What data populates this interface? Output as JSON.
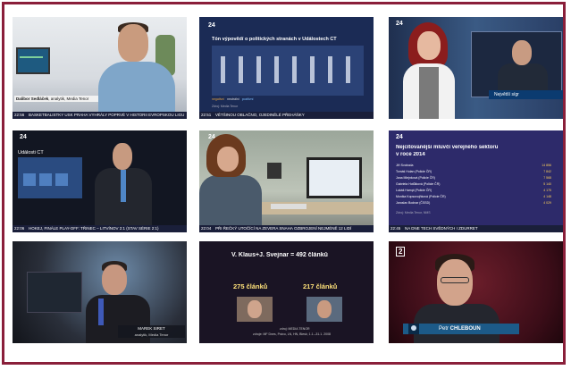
{
  "tiles": {
    "t1": {
      "name_bold": "Dalibor Sedláček",
      "name_rest": ", analytik, Media Tenor",
      "time": "22:56",
      "ticker": "BASKETBALISTKY USK PRAHA VYHRÁLY POPRVÉ V HISTORII EVROPSKOU LIGU"
    },
    "t2": {
      "title": "Tón výpovědí o politických stranách v Událostech ČT",
      "source": "Zdroj: Media Tenor",
      "legend": [
        "negativní",
        "neutrální",
        "pozitivní"
      ],
      "time": "22:51",
      "ticker": "VĚTŠINOU OBLAČNO, OJEDINĚLÉ PŘEHÁŇKY"
    },
    "t3": {
      "caption": "Největší sígr"
    },
    "t4": {
      "panel_title": "Události ČT",
      "time": "22:06",
      "ticker": "HOKEJ, FINÁLE PLAY-OFF: TŘINEC – LITVÍNOV 2:1 (STAV SÉRIE 2:1)"
    },
    "t5": {
      "time": "22:04",
      "ticker": "PŘI ŘEČKÝ UTOČÍCÍ NA ZEVERA SNAHA OZBROJENÍ NEJMÉNĚ 12 LIDÍ"
    },
    "t6": {
      "title_line1": "Nejcitovanější mluvčí veřejného sektoru",
      "title_line2": "v roce 2014",
      "rows": [
        {
          "name": "Jiří Svoboda",
          "value": "14 856"
        },
        {
          "name": "Tomáš Hulan (Policie ČR)",
          "value": "7 842"
        },
        {
          "name": "Jana Mlejnková (Policie ČR)",
          "value": "7 568"
        },
        {
          "name": "Gabriela Hotůlková (Policie ČR)",
          "value": "5 140"
        },
        {
          "name": "Lukáš Hampl (Policie ČR)",
          "value": "4 175"
        },
        {
          "name": "Monika Kopsovojňková (Policie ČR)",
          "value": "4 148"
        },
        {
          "name": "Jaroslav Bodnar (ČSSD)",
          "value": "4 029"
        }
      ],
      "source": "Zdroj: Media Tenor, NMS",
      "time": "22:45",
      "ticker": "NA DNE TECH SVĚDNÝCH I ZDURRET"
    },
    "t7": {
      "name": "MAREK SIRET",
      "role": "analytik, Media Tenor"
    },
    "t8": {
      "title": "V. Klaus+J. Švejnar = 492 článků",
      "count1": "275 článků",
      "count2": "217 článků",
      "source1": "zdroj: MEDIA TENOR",
      "source2": "zdroje: MF Dnes, Právo, LN, HN, Blesk; 1.1.–31.1. 2008"
    },
    "t9": {
      "logo": "2",
      "first": "Petr ",
      "last": "CHLEBOUN"
    }
  },
  "logo": "24"
}
